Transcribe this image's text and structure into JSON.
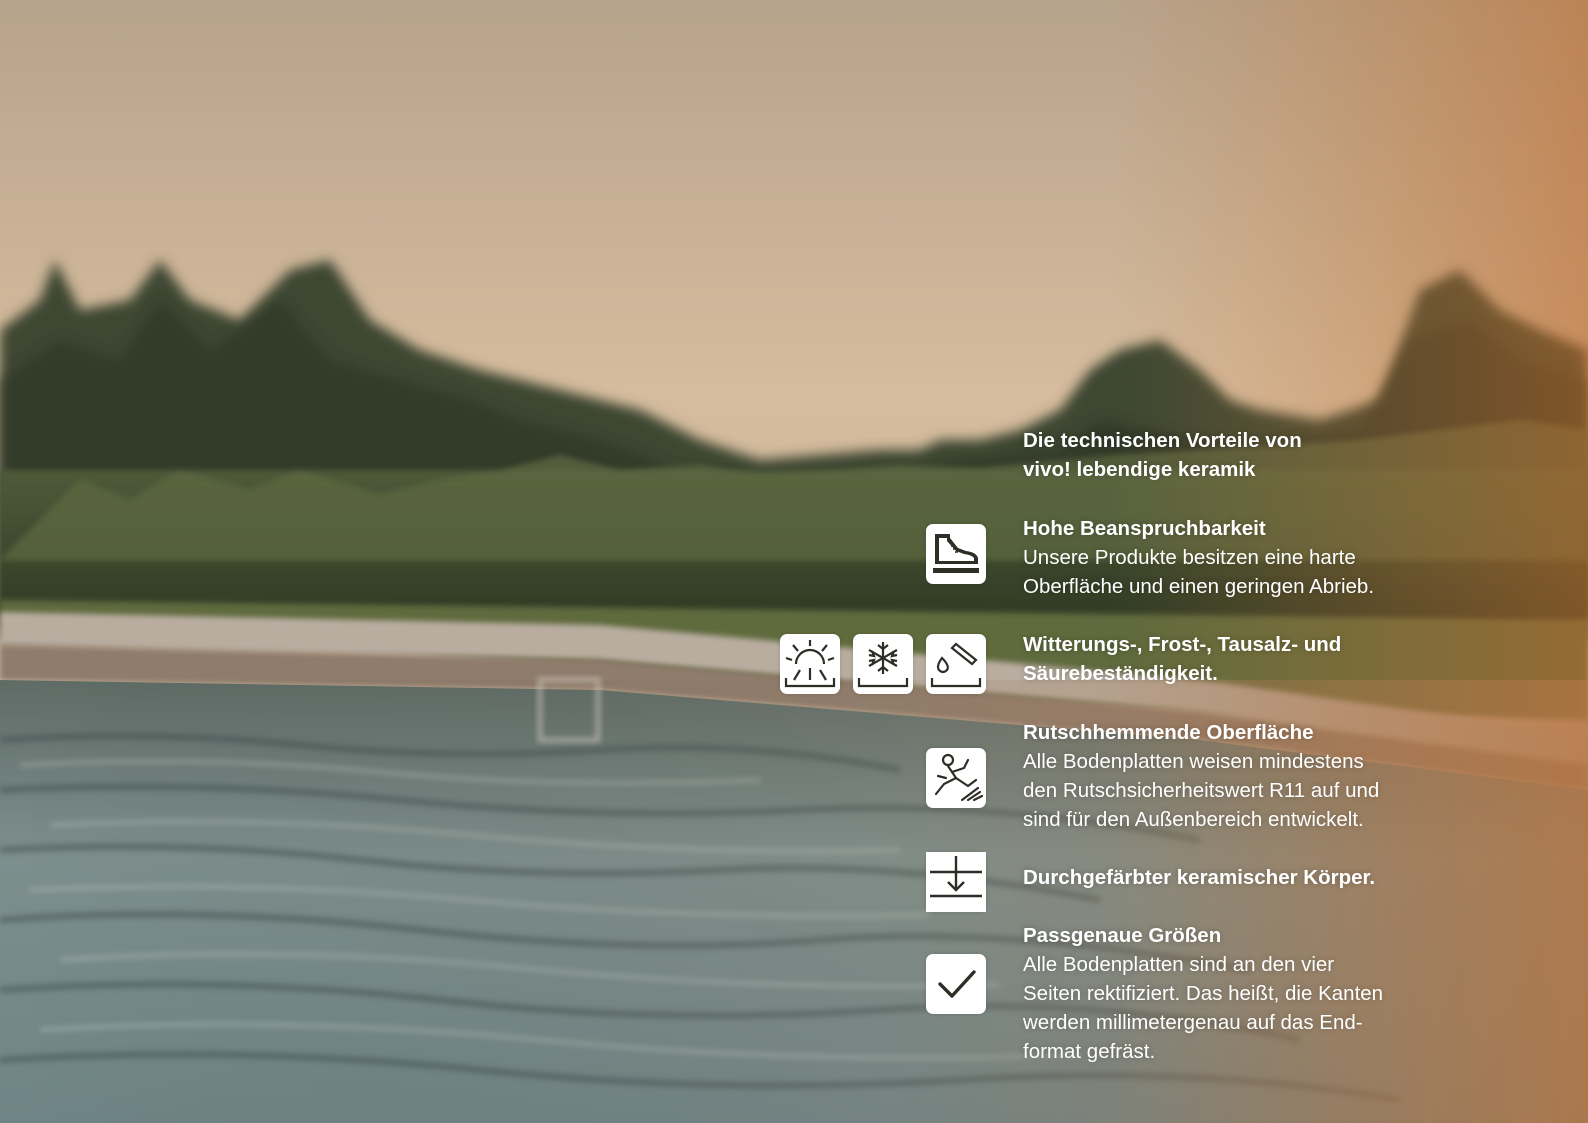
{
  "heading": {
    "line1": "Die technischen Vorteile von",
    "line2": "vivo! lebendige keramik"
  },
  "features": [
    {
      "title": "Hohe Beanspruchbarkeit",
      "body_lines": [
        "Unsere Produkte besitzen eine harte",
        "Oberfläche und einen geringen Abrieb."
      ],
      "icons": [
        "shoe-icon"
      ]
    },
    {
      "title_lines": [
        "Witterungs-, Frost-, Tausalz- und",
        "Säurebeständigkeit."
      ],
      "icons": [
        "sun-icon",
        "snowflake-icon",
        "acid-drop-icon"
      ]
    },
    {
      "title": "Rutschhemmende Oberfläche",
      "body_lines": [
        "Alle Bodenplatten weisen mindestens",
        "den Rutschsicherheitswert R11 auf und",
        "sind für den Außenbereich entwickelt."
      ],
      "icons": [
        "slipping-person-icon"
      ]
    },
    {
      "title": "Durchgefärbter keramischer Körper.",
      "icons": [
        "through-colored-body-icon"
      ]
    },
    {
      "title": "Passgenaue Größen",
      "body_lines": [
        "Alle Bodenplatten sind an den vier",
        "Seiten rektifiziert. Das heißt, die Kanten",
        "werden millimetergenau auf das End-",
        "format gefräst."
      ],
      "icons": [
        "checkmark-icon"
      ]
    }
  ],
  "colors": {
    "text": "#ffffff",
    "icon_bg": "#ffffff",
    "icon_glyph": "#2e2d26"
  }
}
